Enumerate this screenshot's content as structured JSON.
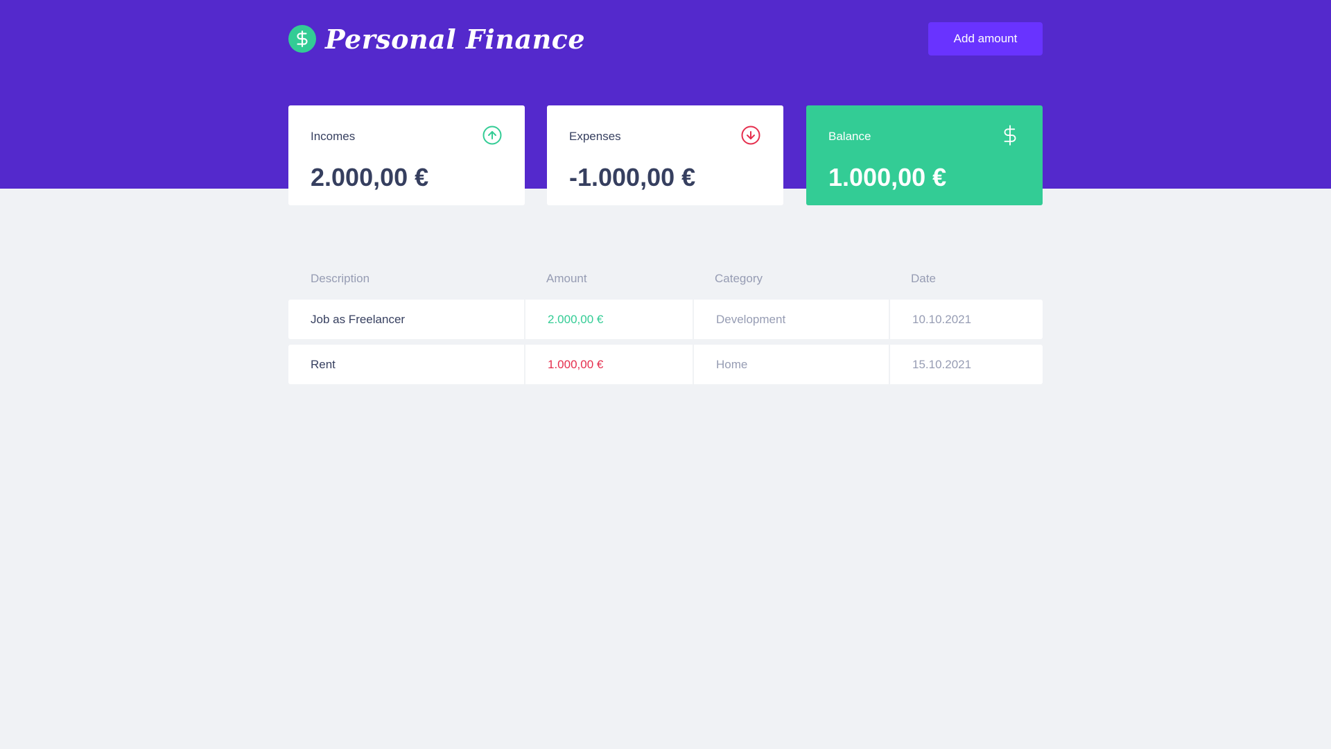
{
  "app": {
    "title": "Personal Finance"
  },
  "header": {
    "add_button_label": "Add amount"
  },
  "summary": {
    "incomes": {
      "label": "Incomes",
      "value": "2.000,00 €",
      "icon": "arrow-up-circle-icon"
    },
    "expenses": {
      "label": "Expenses",
      "value": "-1.000,00 €",
      "icon": "arrow-down-circle-icon"
    },
    "balance": {
      "label": "Balance",
      "value": "1.000,00 €",
      "icon": "dollar-icon"
    }
  },
  "table": {
    "columns": [
      "Description",
      "Amount",
      "Category",
      "Date"
    ],
    "rows": [
      {
        "description": "Job as Freelancer",
        "amount": "2.000,00 €",
        "type": "deposit",
        "category": "Development",
        "date": "10.10.2021"
      },
      {
        "description": "Rent",
        "amount": "1.000,00 €",
        "type": "withdraw",
        "category": "Home",
        "date": "15.10.2021"
      }
    ]
  },
  "colors": {
    "header_bg": "#5429cc",
    "button_bg": "#6933ff",
    "green": "#33cc95",
    "red": "#e52e4d",
    "text": "#363f5f",
    "muted": "#969cb3",
    "page_bg": "#f0f2f5"
  }
}
